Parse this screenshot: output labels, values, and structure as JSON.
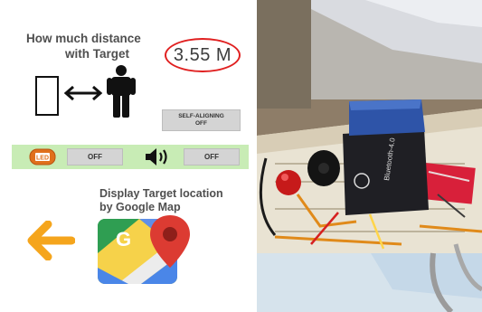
{
  "distance": {
    "title_line1": "How much distance",
    "title_line2": "with Target",
    "value": "3.55 M",
    "value_ring_color": "#e02020"
  },
  "controls": {
    "self_aligning_line1": "SELF-ALIGNING",
    "self_aligning_line2": "OFF",
    "led_icon_label": "LED",
    "led_button": "OFF",
    "sound_button": "OFF",
    "bar_color": "#c8ecb5"
  },
  "map": {
    "heading_line1": "Display Target location",
    "heading_line2": "by Google Map",
    "icon": "google-maps-icon",
    "icon_letter": "G"
  },
  "icons": {
    "target": "target-box-icon",
    "distance_arrow": "double-arrow-icon",
    "person": "person-icon",
    "led": "led-icon",
    "speaker": "speaker-icon",
    "back": "back-arrow-icon"
  },
  "photo": {
    "module_label": "Bluetooth-4.0"
  }
}
